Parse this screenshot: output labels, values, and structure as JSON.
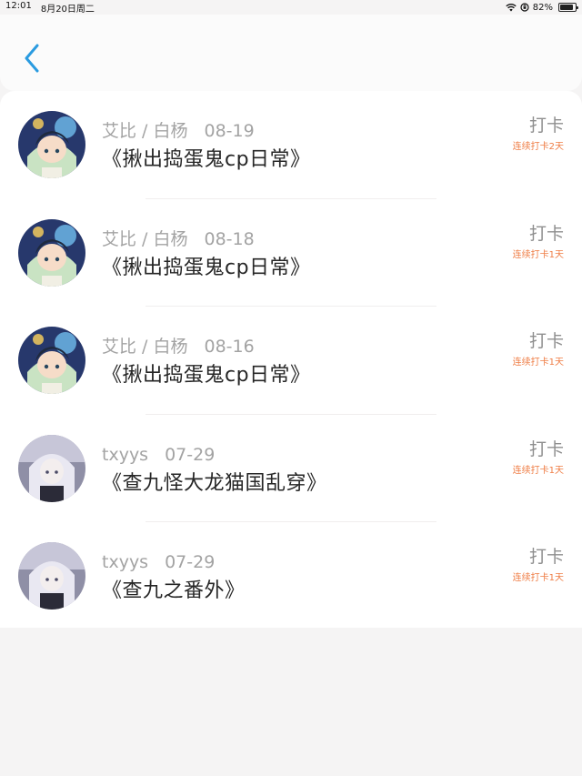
{
  "status_bar": {
    "time": "12:01",
    "date": "8月20日周二",
    "battery": "82%"
  },
  "nav": {
    "back_icon": "chevron-left-icon",
    "accent": "#2a9be0"
  },
  "items": [
    {
      "author": "艾比 / 白杨",
      "date": "08-19",
      "title": "《揪出捣蛋鬼cp日常》",
      "checkin_label": "打卡",
      "streak": "连续打卡2天",
      "avatar": "avatar-a"
    },
    {
      "author": "艾比 / 白杨",
      "date": "08-18",
      "title": "《揪出捣蛋鬼cp日常》",
      "checkin_label": "打卡",
      "streak": "连续打卡1天",
      "avatar": "avatar-a"
    },
    {
      "author": "艾比 / 白杨",
      "date": "08-16",
      "title": "《揪出捣蛋鬼cp日常》",
      "checkin_label": "打卡",
      "streak": "连续打卡1天",
      "avatar": "avatar-a"
    },
    {
      "author": "txyys",
      "date": "07-29",
      "title": "《查九怪大龙猫国乱穿》",
      "checkin_label": "打卡",
      "streak": "连续打卡1天",
      "avatar": "avatar-b"
    },
    {
      "author": "txyys",
      "date": "07-29",
      "title": "《查九之番外》",
      "checkin_label": "打卡",
      "streak": "连续打卡1天",
      "avatar": "avatar-b"
    }
  ],
  "colors": {
    "streak": "#ef7d45",
    "meta": "#a3a3a3",
    "title": "#262626"
  }
}
